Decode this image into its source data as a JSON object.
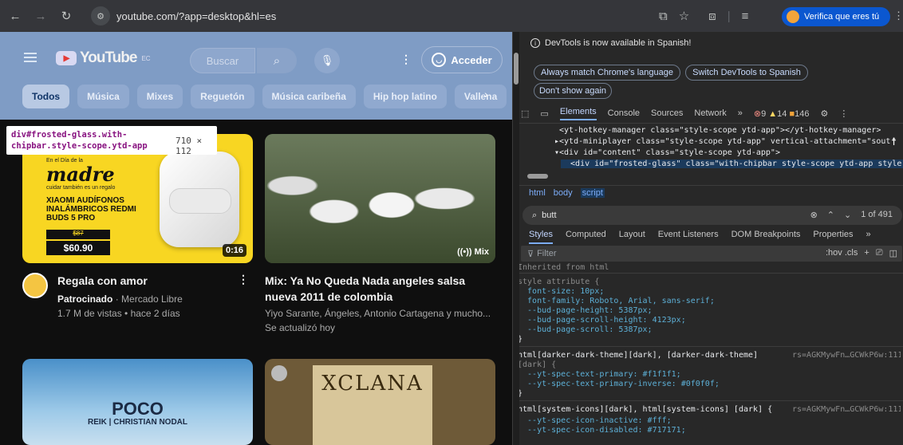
{
  "browser": {
    "url": "youtube.com/?app=desktop&hl=es",
    "verify_label": "Verifica que eres tú"
  },
  "youtube": {
    "logo": "YouTube",
    "region": "EC",
    "search_placeholder": "Buscar",
    "signin": "Acceder",
    "chips": [
      "Todos",
      "Música",
      "Mixes",
      "Reguetón",
      "Música caribeña",
      "Hip hop latino",
      "Vallena"
    ],
    "tooltip": {
      "selector": "div#frosted-glass.with-chipbar.style-scope.ytd-app",
      "size": "710 × 112"
    },
    "ad": {
      "small": "En el Día de la",
      "big": "madre",
      "note": "cuidar también es un regalo",
      "product": "XIAOMI AUDÍFONOS INALÁMBRICOS REDMI BUDS 5 PRO",
      "old_price": "$87",
      "price": "$60.90",
      "duration": "0:16"
    },
    "videos": [
      {
        "title": "Regala con amor",
        "channel": "Patrocinado",
        "channel2": "· Mercado Libre",
        "meta": "1.7 M de vistas • hace 2 días"
      },
      {
        "title": "Mix: Ya No Queda Nada angeles salsa nueva 2011 de colombia",
        "meta": "Yiyo Sarante, Ángeles, Antonio Cartagena y mucho...",
        "meta2": "Se actualizó hoy",
        "badge": "Mix"
      }
    ],
    "poco_title": "POCO",
    "poco_sub": "REIK | CHRISTIAN NODAL",
    "xt_title": "XCLANA"
  },
  "devtools": {
    "info": "DevTools is now available in Spanish!",
    "btn_match": "Always match Chrome's language",
    "btn_switch": "Switch DevTools to Spanish",
    "btn_dont": "Don't show again",
    "tabs": [
      "Elements",
      "Console",
      "Sources",
      "Network"
    ],
    "errors": "9",
    "warnings": "14",
    "issues": "146",
    "dom": [
      "<yt-hotkey-manager class=\"style-scope ytd-app\"></yt-hotkey-manager>",
      "▸<ytd-miniplayer class=\"style-scope ytd-app\" vertical-attachment=\"sout",
      "▾<div id=\"content\" class=\"style-scope ytd-app\">",
      "  <div id=\"frosted-glass\" class=\"with-chipbar style-scope ytd-app style-s"
    ],
    "crumbs": [
      "html",
      "body",
      "script"
    ],
    "search_value": "butt",
    "search_count": "1 of 491",
    "style_tabs": [
      "Styles",
      "Computed",
      "Layout",
      "Event Listeners",
      "DOM Breakpoints",
      "Properties"
    ],
    "filter_placeholder": "Filter",
    "filter_tools": ":hov .cls",
    "inherited": "Inherited from html",
    "style_rule": [
      "style attribute {",
      "  font-size: 10px;",
      "  font-family: Roboto, Arial, sans-serif;",
      "  --bud-page-height: 5387px;",
      "  --bud-page-scroll-height: 4123px;",
      "  --bud-page-scroll: 5387px;",
      "}"
    ],
    "rule2_sel": "html[darker-dark-theme][dark], [darker-dark-theme]",
    "rule2_sel2": "[dark] {",
    "rule2_src": "rs=AGKMywFn…GCWkP6w:111",
    "rule2_props": [
      "  --yt-spec-text-primary: #f1f1f1;",
      "  --yt-spec-text-primary-inverse: #0f0f0f;"
    ],
    "rule3_sel": "html[system-icons][dark], html[system-icons] [dark] {",
    "rule3_src": "rs=AGKMywFn…GCWkP6w:111",
    "rule3_props": [
      "  --yt-spec-icon-inactive: #fff;",
      "  --yt-spec-icon-disabled: #717171;"
    ]
  }
}
